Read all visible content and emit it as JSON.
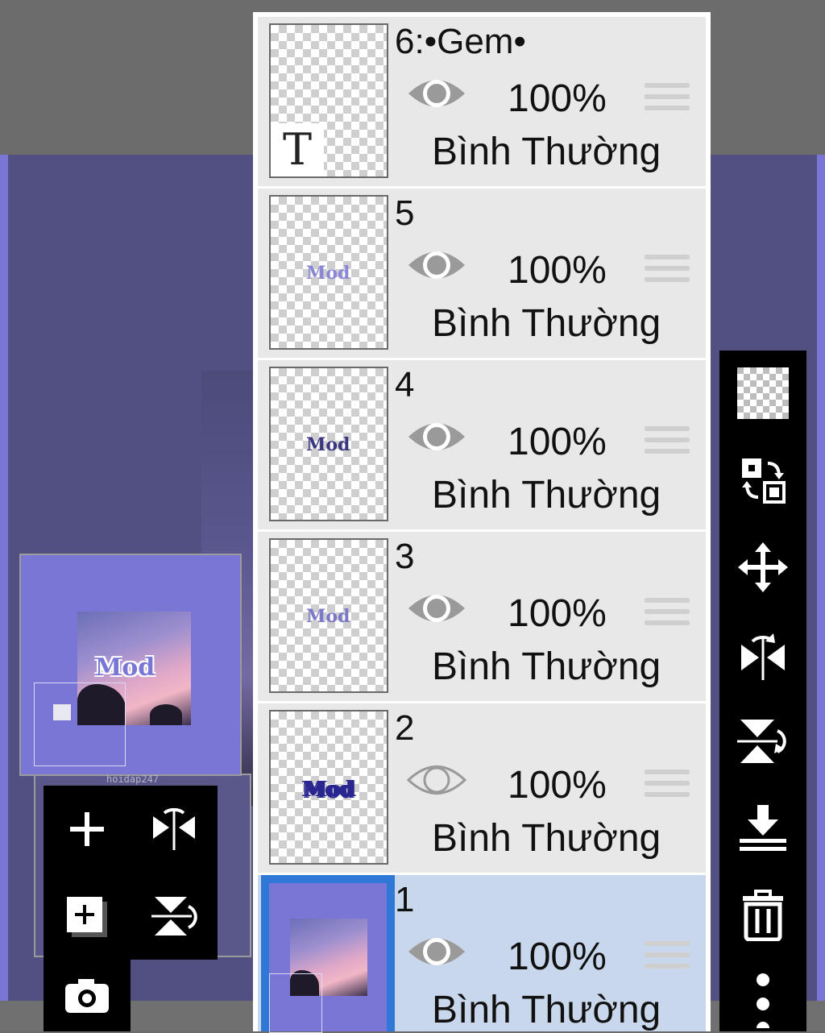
{
  "layers": [
    {
      "name": "6:•Gem•",
      "opacity": "100%",
      "blend": "Bình Thường",
      "visible": true,
      "thumb_icon": "text-layer-icon",
      "thumb_letter": "T"
    },
    {
      "name": "5",
      "opacity": "100%",
      "blend": "Bình Thường",
      "visible": true,
      "thumb_icon": "logo-outline-icon"
    },
    {
      "name": "4",
      "opacity": "100%",
      "blend": "Bình Thường",
      "visible": true,
      "thumb_icon": "logo-dark-icon"
    },
    {
      "name": "3",
      "opacity": "100%",
      "blend": "Bình Thường",
      "visible": true,
      "thumb_icon": "logo-light-icon"
    },
    {
      "name": "2",
      "opacity": "100%",
      "blend": "Bình Thường",
      "visible": false,
      "thumb_icon": "logo-solid-icon"
    },
    {
      "name": "1",
      "opacity": "100%",
      "blend": "Bình Thường",
      "visible": true,
      "selected": true,
      "thumb_icon": "photo-icon"
    }
  ],
  "preview": {
    "caption": "hoidap247"
  },
  "left_tools": [
    "add-layer-icon",
    "flip-horizontal-icon",
    "add-copy-layer-icon",
    "flip-vertical-icon",
    "camera-icon"
  ],
  "right_tools": [
    "transparent-icon",
    "swap-layers-icon",
    "move-icon",
    "flip-horizontal-icon",
    "flip-vertical-icon",
    "merge-down-icon",
    "trash-icon",
    "more-icon"
  ],
  "colors": {
    "accent": "#7a76d6",
    "selected_layer": "#c9d7ec",
    "panel": "#e8e8e8"
  }
}
